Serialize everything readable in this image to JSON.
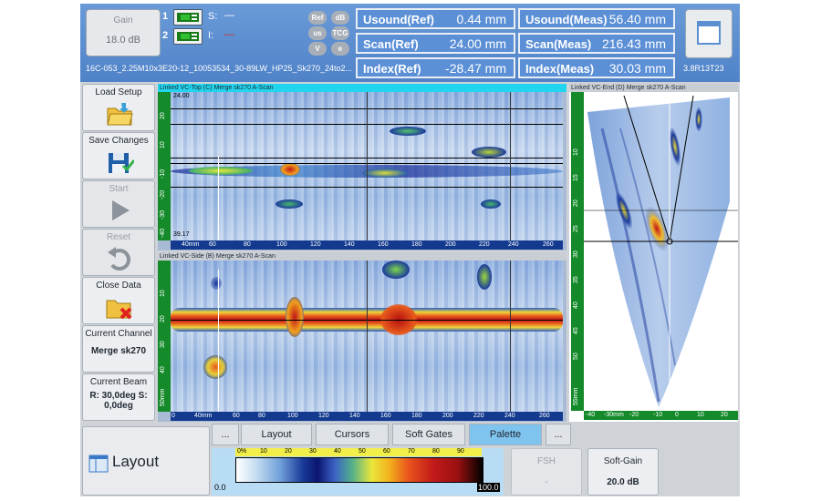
{
  "header": {
    "gain_label": "Gain",
    "gain_value": "18.0 dB",
    "channel1": {
      "num": "1",
      "s_label": "S:",
      "s_value": "—"
    },
    "channel2": {
      "num": "2",
      "i_label": "I:",
      "i_value": "—"
    },
    "pills": [
      "Ref",
      "dB",
      "us",
      "TCG",
      "V",
      "e"
    ],
    "readouts": [
      {
        "label": "Usound(Ref)",
        "value": "0.44 mm"
      },
      {
        "label": "Scan(Ref)",
        "value": "24.00 mm"
      },
      {
        "label": "Index(Ref)",
        "value": "-28.47 mm"
      },
      {
        "label": "Usound(Meas)",
        "value": "56.40 mm"
      },
      {
        "label": "Scan(Meas)",
        "value": "216.43 mm"
      },
      {
        "label": "Index(Meas)",
        "value": "30.03 mm"
      }
    ],
    "filename": "16C-053_2.25M10x3E20-12_10053534_30-89LW_HP25_Sk270_24to2...",
    "version": "3.8R13T23"
  },
  "sidebar": {
    "load_setup": "Load Setup",
    "save_changes": "Save Changes",
    "start": "Start",
    "reset": "Reset",
    "close_data": "Close Data",
    "current_channel_label": "Current Channel",
    "current_channel_value": "Merge sk270",
    "current_beam_label": "Current Beam",
    "current_beam_value": "R: 30,0deg S: 0,0deg"
  },
  "scans": {
    "top": {
      "title": "Linked VC-Top (C) Merge sk270 A-Scan",
      "overlay_top": "24.00",
      "overlay_bottom": "39.17",
      "v_ticks": [
        "20",
        "10",
        "-10",
        "-20",
        "-30",
        "-40"
      ],
      "h_ticks": [
        "40mm",
        "60",
        "80",
        "100",
        "120",
        "140",
        "160",
        "180",
        "200",
        "220",
        "240",
        "260"
      ]
    },
    "side": {
      "title": "Linked VC-Side (B) Merge sk270 A-Scan",
      "v_ticks": [
        "10",
        "20",
        "30",
        "40",
        "50mm"
      ],
      "h_ticks": [
        "0",
        "40mm",
        "60",
        "80",
        "100",
        "120",
        "140",
        "160",
        "180",
        "200",
        "220",
        "240",
        "260"
      ]
    },
    "end": {
      "title": "Linked VC-End (D) Merge sk270 A-Scan",
      "v_ticks": [
        "10",
        "15",
        "20",
        "25",
        "30",
        "35",
        "40",
        "45",
        "50",
        "55mm"
      ],
      "h_ticks": [
        "-40",
        "-30mm",
        "-20",
        "-10",
        "0",
        "10",
        "20"
      ]
    }
  },
  "tabs": {
    "more_left": "...",
    "layout": "Layout",
    "cursors": "Cursors",
    "soft_gates": "Soft Gates",
    "palette": "Palette",
    "more_right": "..."
  },
  "bottom": {
    "layout_title": "Layout",
    "palette_min": "0.0",
    "palette_max": "100.0",
    "palette_ticks": [
      "0%",
      "10",
      "20",
      "30",
      "40",
      "50",
      "60",
      "70",
      "80",
      "90"
    ],
    "fsh_label": "FSH",
    "fsh_value": "-",
    "softgain_label": "Soft-Gain",
    "softgain_value": "20.0 dB"
  },
  "colors": {
    "header": "#5b8fd6",
    "active_tab": "#7fc4ef",
    "ruler_v": "#148a2a",
    "ruler_h": "#133a8f",
    "top_scan_bar": "#22d5ee"
  }
}
